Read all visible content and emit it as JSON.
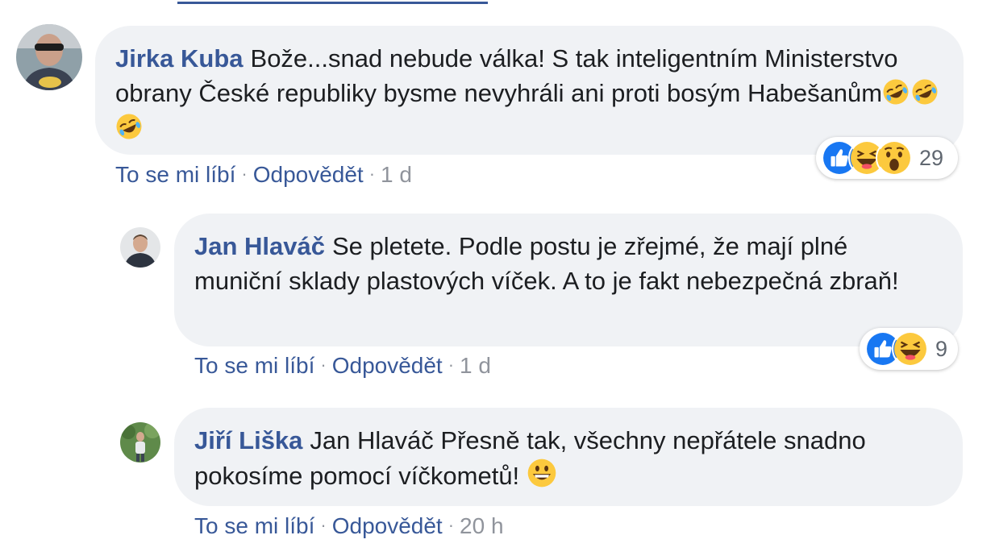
{
  "comments": [
    {
      "author": "Jirka Kuba",
      "text": "Bože...snad nebude válka! S tak inteligentním Ministerstvo obrany České republiky bysme nevyhráli ani proti bosým Habešanům",
      "trailing_emojis": [
        "rolling-on-floor-laughing",
        "rolling-on-floor-laughing",
        "rolling-on-floor-laughing"
      ],
      "actions": {
        "like": "To se mi líbí",
        "reply": "Odpovědět",
        "separator": "·",
        "time": "1 d"
      },
      "reactions": {
        "types": [
          "like",
          "haha",
          "wow"
        ],
        "count": "29"
      }
    },
    {
      "author": "Jan Hlaváč",
      "text": "Se pletete. Podle postu je zřejmé, že mají plné muniční sklady plastových víček. A to je fakt nebezpečná zbraň!",
      "actions": {
        "like": "To se mi líbí",
        "reply": "Odpovědět",
        "separator": "·",
        "time": "1 d"
      },
      "reactions": {
        "types": [
          "like",
          "haha"
        ],
        "count": "9"
      }
    },
    {
      "author": "Jiří Liška",
      "text": "Jan Hlaváč Přesně tak, všechny nepřátele snadno pokosíme pomocí víčkometů!",
      "trailing_emojis": [
        "grinning-face"
      ],
      "actions": {
        "like": "To se mi líbí",
        "reply": "Odpovědět",
        "separator": "·",
        "time": "20 h"
      }
    }
  ],
  "colors": {
    "link": "#385898",
    "bubble_bg": "#f0f2f5",
    "text": "#1c1e21",
    "meta": "#90949c",
    "like_blue": "#1877f2",
    "emoji_yellow": "#fcc93e"
  }
}
